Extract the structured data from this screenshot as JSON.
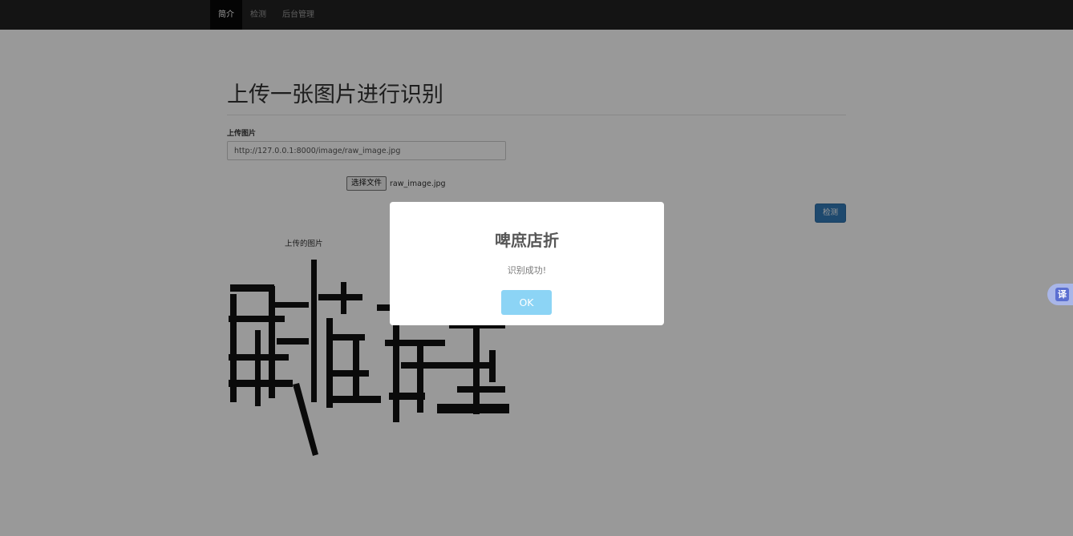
{
  "nav": {
    "items": [
      {
        "label": "简介",
        "active": true
      },
      {
        "label": "检测",
        "active": false
      },
      {
        "label": "后台管理",
        "active": false
      }
    ]
  },
  "main": {
    "title": "上传一张图片进行识别",
    "upload_label": "上传图片",
    "url_value": "http://127.0.0.1:8000/image/raw_image.jpg",
    "file_button_label": "选择文件",
    "file_name": "raw_image.jpg",
    "detect_button_label": "检测",
    "image_caption": "上传的图片"
  },
  "modal": {
    "title": "啤庶店折",
    "message": "识别成功!",
    "ok_label": "OK"
  },
  "translate": {
    "icon_char": "译"
  },
  "colors": {
    "navbar": "#222222",
    "primary_button": "#337ab7",
    "ok_button": "#8cd4f5"
  }
}
